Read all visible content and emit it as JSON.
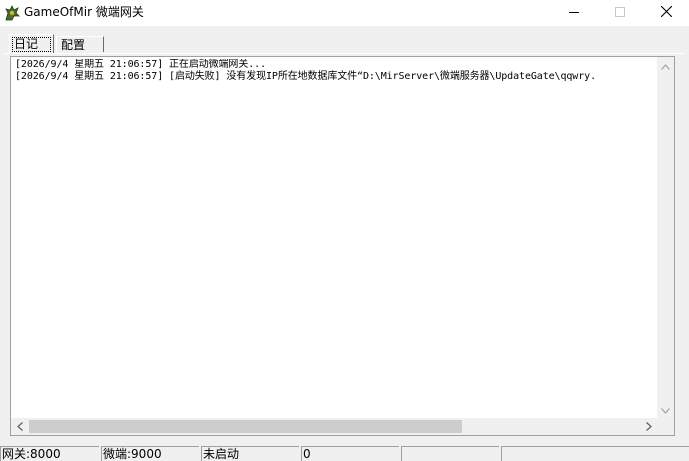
{
  "window": {
    "title": "GameOfMir 微端网关",
    "icon": "game-dragon-icon"
  },
  "tabs": [
    {
      "label": "日记",
      "active": true
    },
    {
      "label": "配置",
      "active": false
    }
  ],
  "log": {
    "lines": [
      "[2026/9/4 星期五 21:06:57] 正在启动微端网关...",
      "[2026/9/4 星期五 21:06:57] [启动失败] 没有发现IP所在地数据库文件“D:\\MirServer\\微端服务器\\UpdateGate\\qqwry."
    ]
  },
  "statusbar": {
    "gateway": "网关:8000",
    "microclient": "微端:9000",
    "state": "未启动",
    "count": "0",
    "panel5": "",
    "panel6": ""
  },
  "colors": {
    "titlebar_bg": "#ffffff",
    "window_bg": "#f0f0f0",
    "scroll_thumb": "#cdcdcd"
  }
}
